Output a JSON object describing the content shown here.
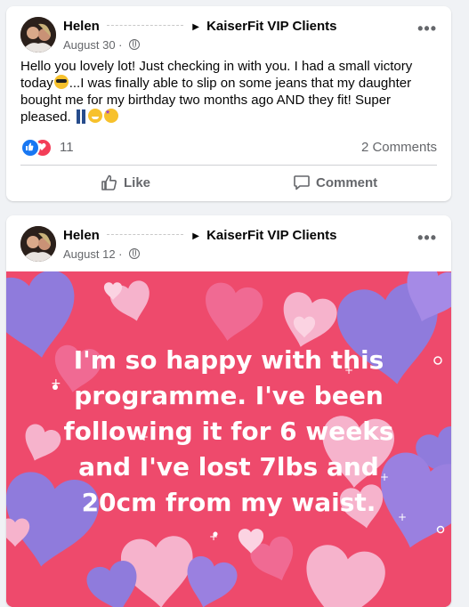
{
  "posts": [
    {
      "author": "Helen",
      "group": "KaiserFit VIP Clients",
      "date": "August 30",
      "text_parts": [
        "Hello you lovely lot! Just checking in with you. I had a small victory today",
        "...I was finally able to slip on some jeans that my daughter bought me for my birthday two months ago AND they fit! Super pleased. "
      ],
      "reaction_count": "11",
      "comments_label": "2 Comments",
      "like_label": "Like",
      "comment_label": "Comment",
      "more_label": "•••"
    },
    {
      "author": "Helen",
      "group": "KaiserFit VIP Clients",
      "date": "August 12",
      "more_label": "•••",
      "image_text": "I'm so happy with this programme. I've been following it for 6 weeks and I've lost 7lbs and 20cm from my waist.",
      "image_colors": {
        "background": "#ee4a6c",
        "heart_purple": "#8f7bdc",
        "heart_pink": "#f6b3cc"
      }
    }
  ]
}
